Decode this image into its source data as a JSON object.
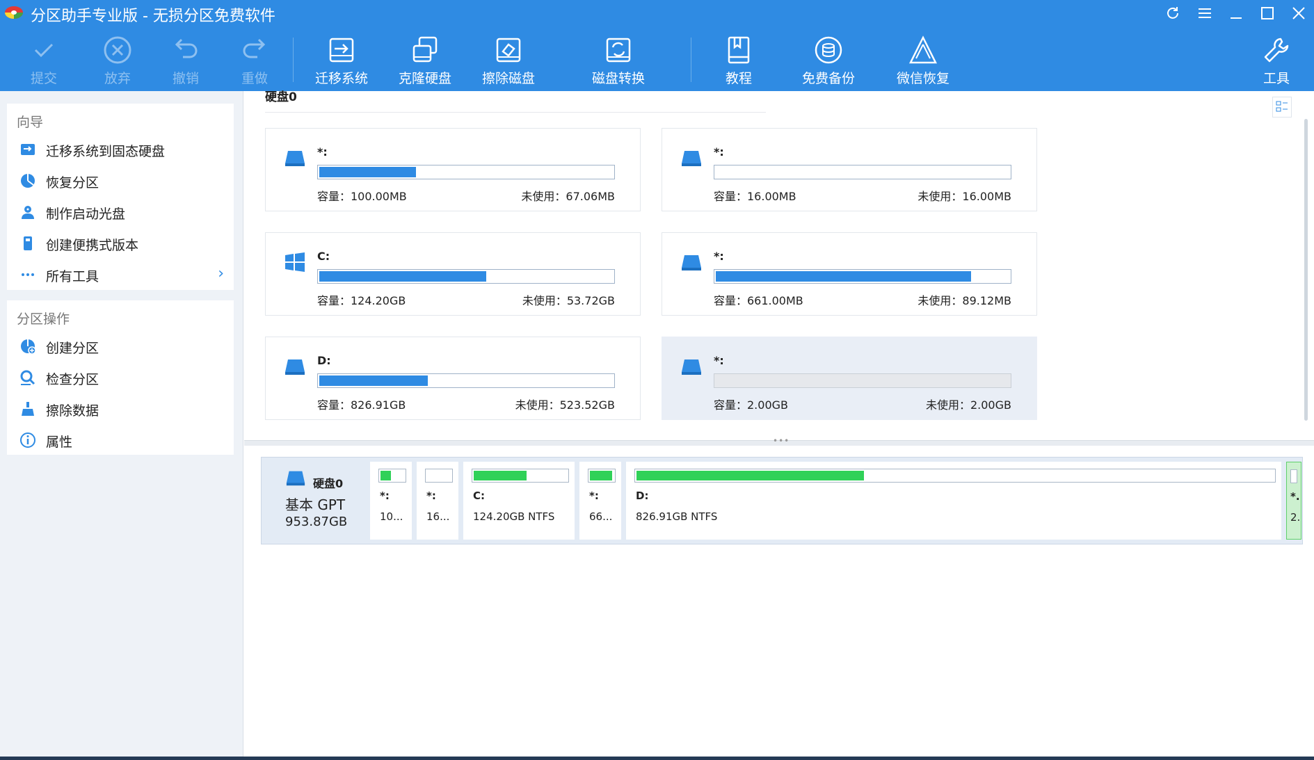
{
  "window": {
    "title": "分区助手专业版 - 无损分区免费软件"
  },
  "toolbar": {
    "commit": "提交",
    "discard": "放弃",
    "undo": "撤销",
    "redo": "重做",
    "migrate_os": "迁移系统",
    "clone_disk": "克隆硬盘",
    "wipe_disk": "擦除磁盘",
    "disk_convert": "磁盘转换",
    "tutorial": "教程",
    "free_backup": "免费备份",
    "wechat_recovery": "微信恢复",
    "tools": "工具"
  },
  "sidebar": {
    "wizard_title": "向导",
    "wizard_items": [
      {
        "label": "迁移系统到固态硬盘",
        "icon": "migrate-icon"
      },
      {
        "label": "恢复分区",
        "icon": "pie-icon"
      },
      {
        "label": "制作启动光盘",
        "icon": "disc-user-icon"
      },
      {
        "label": "创建便携式版本",
        "icon": "usb-icon"
      },
      {
        "label": "所有工具",
        "icon": "more-icon"
      }
    ],
    "ops_title": "分区操作",
    "ops_items": [
      {
        "label": "创建分区",
        "icon": "create-partition-icon"
      },
      {
        "label": "检查分区",
        "icon": "check-icon"
      },
      {
        "label": "擦除数据",
        "icon": "broom-icon"
      },
      {
        "label": "属性",
        "icon": "info-icon"
      }
    ]
  },
  "main": {
    "disk_title": "硬盘0",
    "partitions": [
      {
        "name": "*:",
        "capacity": "容量：100.00MB",
        "free": "未使用：67.06MB",
        "used_fraction": 0.33,
        "icon": "drive-icon"
      },
      {
        "name": "*:",
        "capacity": "容量：16.00MB",
        "free": "未使用：16.00MB",
        "used_fraction": 0.0,
        "icon": "drive-icon"
      },
      {
        "name": "C:",
        "capacity": "容量：124.20GB",
        "free": "未使用：53.72GB",
        "used_fraction": 0.57,
        "icon": "windows-icon"
      },
      {
        "name": "*:",
        "capacity": "容量：661.00MB",
        "free": "未使用：89.12MB",
        "used_fraction": 0.87,
        "icon": "drive-icon"
      },
      {
        "name": "D:",
        "capacity": "容量：826.91GB",
        "free": "未使用：523.52GB",
        "used_fraction": 0.37,
        "icon": "drive-icon"
      },
      {
        "name": "*:",
        "capacity": "容量：2.00GB",
        "free": "未使用：2.00GB",
        "used_fraction": 0.0,
        "icon": "drive-icon",
        "unallocated": true
      }
    ],
    "disk_map": {
      "name": "硬盘0",
      "type": "基本 GPT",
      "size": "953.87GB",
      "segments": [
        {
          "name": "*:",
          "info": "10...",
          "used_fraction": 0.4
        },
        {
          "name": "*:",
          "info": "16...",
          "used_fraction": 0.0
        },
        {
          "name": "C:",
          "info": "124.20GB NTFS",
          "used_fraction": 0.57
        },
        {
          "name": "*:",
          "info": "66...",
          "used_fraction": 0.87
        },
        {
          "name": "D:",
          "info": "826.91GB NTFS",
          "used_fraction": 0.37
        },
        {
          "name": "*.",
          "info": "2.",
          "used_fraction": 0.0
        }
      ]
    }
  },
  "colors": {
    "accent": "#2f8be3",
    "used_bar": "#2f8be3",
    "map_used": "#30d158",
    "selected_card": "#e9eef6"
  }
}
